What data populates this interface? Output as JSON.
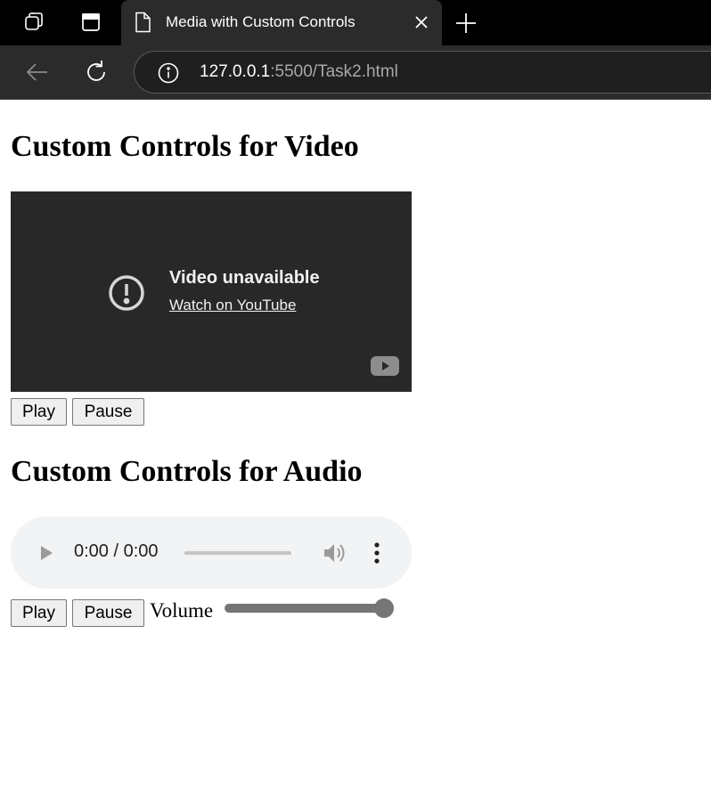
{
  "browser": {
    "tab": {
      "title": "Media with Custom Controls"
    },
    "address_bar": {
      "host": "127.0.0.1",
      "path": ":5500/Task2.html"
    }
  },
  "video_section": {
    "heading": "Custom Controls for Video",
    "player": {
      "message": "Video unavailable",
      "link_label": "Watch on YouTube"
    },
    "controls": {
      "play_label": "Play",
      "pause_label": "Pause"
    }
  },
  "audio_section": {
    "heading": "Custom Controls for Audio",
    "player": {
      "time": "0:00 / 0:00"
    },
    "controls": {
      "play_label": "Play",
      "pause_label": "Pause",
      "volume_label": "Volume"
    },
    "volume_level": 1.0
  },
  "colors": {
    "tabbar_bg": "#000000",
    "chrome_bg": "#2b2b2b",
    "video_bg": "#282828",
    "audio_bg": "#f1f3f4",
    "slider": "#757575"
  }
}
